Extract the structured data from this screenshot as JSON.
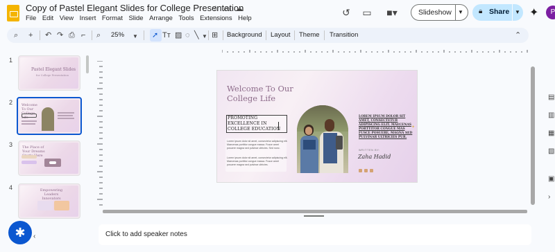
{
  "app": {
    "title": "Copy of Pastel Elegant Slides for College Presentation",
    "menu": [
      "File",
      "Edit",
      "View",
      "Insert",
      "Format",
      "Slide",
      "Arrange",
      "Tools",
      "Extensions",
      "Help"
    ],
    "slideshow_label": "Slideshow",
    "share_label": "Share",
    "avatar_letter": "P"
  },
  "toolbar": {
    "zoom": "25%",
    "background": "Background",
    "layout": "Layout",
    "theme": "Theme",
    "transition": "Transition"
  },
  "filmstrip": [
    {
      "num": "1",
      "title": "Pastel Elegant Slides",
      "subtitle": "for College Presentation"
    },
    {
      "num": "2",
      "title": "Welcome To Our College Life"
    },
    {
      "num": "3",
      "title": "The Place of Your Dreams Starts Here"
    },
    {
      "num": "4",
      "title": "Empowering Leaders Innovators"
    }
  ],
  "slide": {
    "title_line1": "Welcome To Our",
    "title_line2": "College Life",
    "box_line1": "PROMOTING",
    "box_line2": "EXCELLENCE IN",
    "box_line3": "COLLEGE EDUCATION",
    "body1": "Lorem ipsum dolor sit amet, consectetur adipiscing elit. Maecenas porttitor congue massa. Fusce amet posuere magna sed pulvinar ultricies. Sed nunc.",
    "body2": "Lorem ipsum dolor sit amet, consectetur adipiscing elit. Maecenas porttitor congue massa. Fusce amet posuere magna sed pulvinar ultricies.",
    "right_text": "LOREM IPSUM DOLOR SIT AMET, CONSECTETUR ADIPISCING ELIT. MAECENAS PORTTITOR CONGUE MAS FUSCE POSUERE, MAGNA SED PULVINAR ULTRICIES PUR.",
    "written_by": "WRITTEN BY:",
    "author": "Zaha Hadid"
  },
  "notes": {
    "placeholder": "Click to add speaker notes"
  }
}
